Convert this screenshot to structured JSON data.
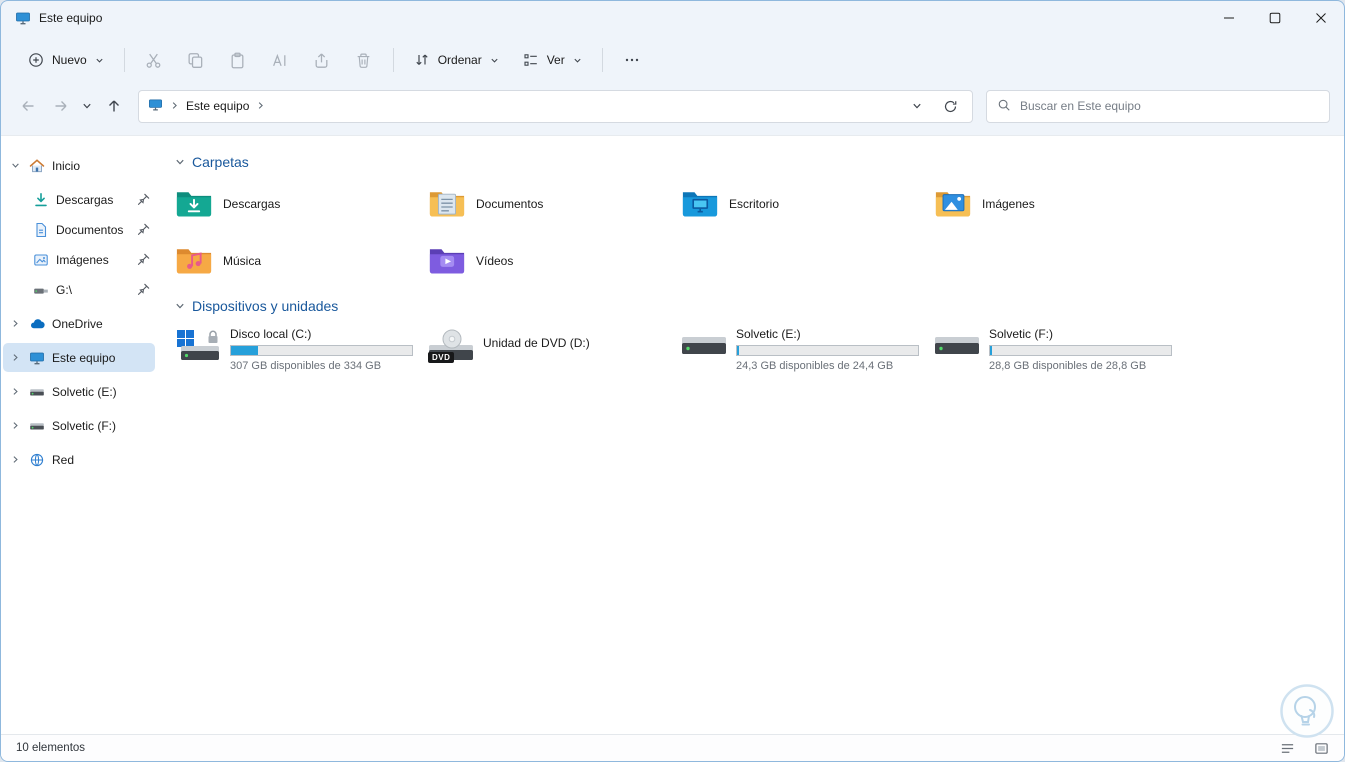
{
  "colors": {
    "selection": "#d3e4f5",
    "progress_fill": "#26a0da",
    "section_header": "#19589c",
    "chrome_background": "#eff4fa"
  },
  "window": {
    "title": "Este equipo"
  },
  "toolbar": {
    "new_label": "Nuevo",
    "sort_label": "Ordenar",
    "view_label": "Ver"
  },
  "navbar": {
    "breadcrumb_root": "Este equipo",
    "search_placeholder": "Buscar en Este equipo"
  },
  "sidebar": {
    "items": [
      {
        "label": "Inicio"
      },
      {
        "label": "Descargas"
      },
      {
        "label": "Documentos"
      },
      {
        "label": "Imágenes"
      },
      {
        "label": "G:\\"
      },
      {
        "label": "OneDrive"
      },
      {
        "label": "Este equipo"
      },
      {
        "label": "Solvetic (E:)"
      },
      {
        "label": "Solvetic (F:)"
      },
      {
        "label": "Red"
      }
    ]
  },
  "content": {
    "folders": {
      "title": "Carpetas",
      "items": [
        {
          "label": "Descargas"
        },
        {
          "label": "Documentos"
        },
        {
          "label": "Escritorio"
        },
        {
          "label": "Imágenes"
        },
        {
          "label": "Música"
        },
        {
          "label": "Vídeos"
        }
      ]
    },
    "devices": {
      "title": "Dispositivos y unidades",
      "items": [
        {
          "label": "Disco local (C:)",
          "free_text": "307 GB disponibles de 334 GB",
          "used_percent": 15
        },
        {
          "label": "Unidad de DVD (D:)",
          "badge": "DVD"
        },
        {
          "label": "Solvetic (E:)",
          "free_text": "24,3 GB disponibles de 24,4 GB",
          "used_percent": 1
        },
        {
          "label": "Solvetic (F:)",
          "free_text": "28,8 GB disponibles de 28,8 GB",
          "used_percent": 1
        }
      ]
    }
  },
  "statusbar": {
    "items_count": "10 elementos"
  }
}
